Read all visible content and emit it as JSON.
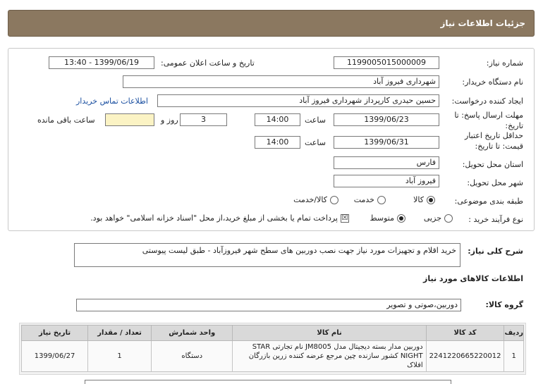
{
  "header": {
    "title": "جزئیات اطلاعات نیاز"
  },
  "form": {
    "need_number_label": "شماره نیاز:",
    "need_number": "1199005015000009",
    "announce_label": "تاریخ و ساعت اعلان عمومی:",
    "announce_value": "1399/06/19 - 13:40",
    "buyer_org_label": "نام دستگاه خریدار:",
    "buyer_org": "شهرداری فیروز آباد",
    "requester_label": "ایجاد کننده درخواست:",
    "requester": "حسین حیدری کارپرداز شهرداری فیروز آباد",
    "contact_link": "اطلاعات تماس خریدار",
    "reply_deadline_label": "مهلت ارسال پاسخ: تا تاریخ:",
    "reply_date": "1399/06/23",
    "time_label": "ساعت",
    "reply_time": "14:00",
    "days_value": "3",
    "days_label": "روز و",
    "remaining_value": "",
    "remaining_label": "ساعت باقی مانده",
    "validity_label_1": "حداقل تاریخ اعتبار",
    "validity_label_2": "قیمت: تا تاریخ:",
    "validity_date": "1399/06/31",
    "validity_time": "14:00",
    "province_label": "استان محل تحویل:",
    "province": "فارس",
    "city_label": "شهر محل تحویل:",
    "city": "فیروز آباد",
    "category_label": "طبقه بندی موضوعی:",
    "category_options": [
      "کالا",
      "خدمت",
      "کالا/خدمت"
    ],
    "process_label": "نوع فرآیند خرید :",
    "process_options": [
      "جزیی",
      "متوسط"
    ],
    "payment_note": "پرداخت تمام یا بخشی از مبلغ خرید،از محل \"اسناد خزانه اسلامی\" خواهد بود."
  },
  "summary": {
    "label": "شرح کلی نیاز:",
    "text": "خرید اقلام و تجهیزات مورد نیاز جهت نصب دوربین های سطح شهر فیروزآباد - طبق لیست پیوستی"
  },
  "goods": {
    "section_label": "اطلاعات کالاهای مورد نیاز",
    "group_label": "گروه کالا:",
    "group_value": "دوربین،صوتی و تصویر",
    "columns": [
      "ردیف",
      "کد کالا",
      "نام کالا",
      "واحد شمارش",
      "تعداد / مقدار",
      "تاریخ نیاز"
    ],
    "rows": [
      {
        "index": "1",
        "code": "2241220665220012",
        "name": "دوربین مدار بسته دیجیتال مدل JM8005 نام تجارتی STAR NIGHT کشور سازنده چین مرجع عرضه کننده زرین بازرگان افلاک",
        "unit": "دستگاه",
        "qty": "1",
        "date": "1399/06/27"
      }
    ]
  }
}
